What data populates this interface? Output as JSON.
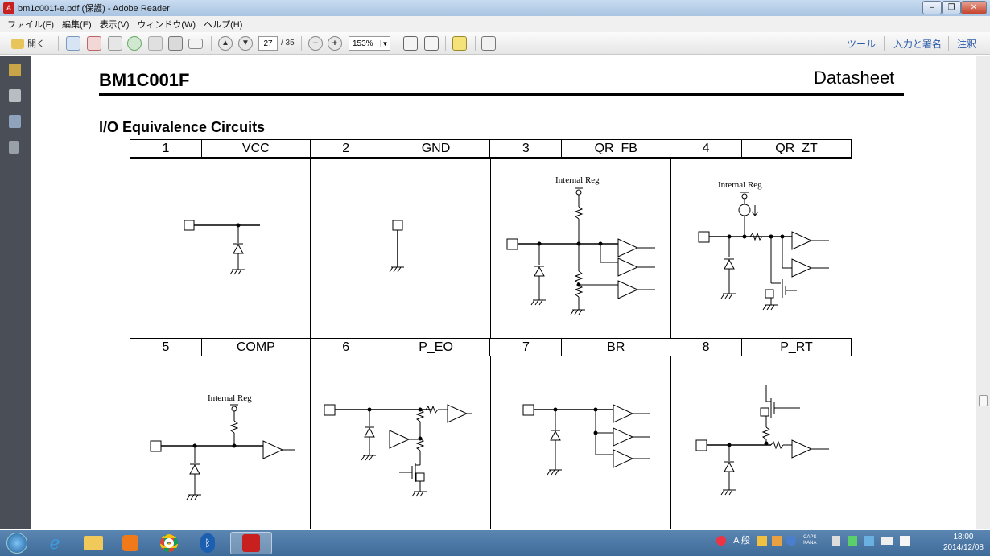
{
  "window": {
    "title": "bm1c001f-e.pdf (保護) - Adobe Reader"
  },
  "menu": [
    "ファイル(F)",
    "編集(E)",
    "表示(V)",
    "ウィンドウ(W)",
    "ヘルプ(H)"
  ],
  "toolbar": {
    "open_label": "開く",
    "page_current": "27",
    "page_total": "/ 35",
    "zoom": "153%",
    "tools_label": "ツール",
    "fill_sign_label": "入力と署名",
    "comment_label": "注釈"
  },
  "document": {
    "part_number": "BM1C001F",
    "doc_type": "Datasheet",
    "section_title": "I/O Equivalence Circuits",
    "pins": [
      {
        "num": "1",
        "name": "VCC"
      },
      {
        "num": "2",
        "name": "GND"
      },
      {
        "num": "3",
        "name": "QR_FB"
      },
      {
        "num": "4",
        "name": "QR_ZT"
      },
      {
        "num": "5",
        "name": "COMP"
      },
      {
        "num": "6",
        "name": "P_EO"
      },
      {
        "num": "7",
        "name": "BR"
      },
      {
        "num": "8",
        "name": "P_RT"
      }
    ],
    "internal_reg_label": "Internal Reg"
  },
  "taskbar": {
    "ime_label": "A 般",
    "caps_label": "CAPS",
    "kana_label": "KANA",
    "time": "18:00",
    "date": "2014/12/08"
  },
  "colors": {
    "accent": "#c8201e",
    "taskbar": "#4a76a4"
  }
}
